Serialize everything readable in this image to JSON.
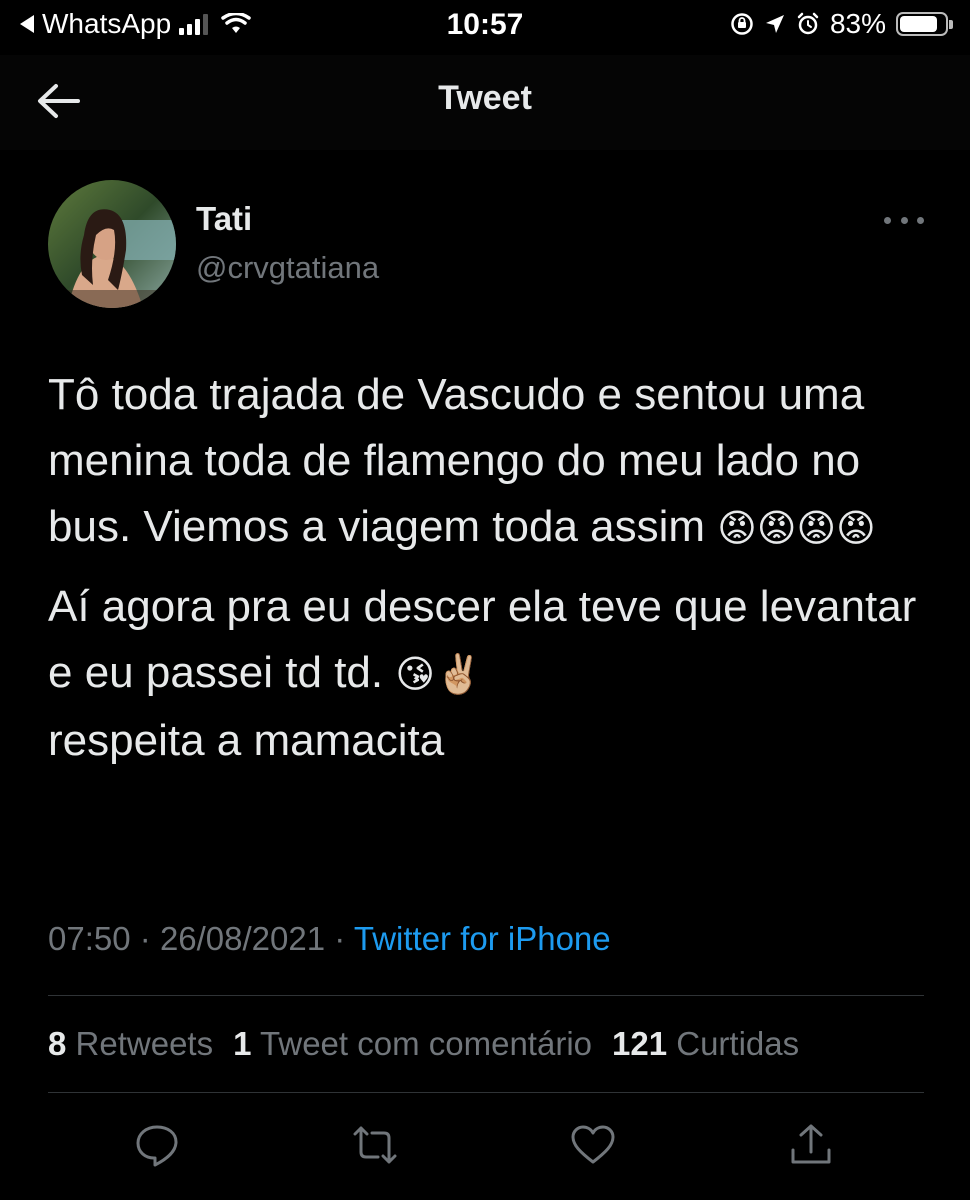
{
  "status_bar": {
    "back_app": "WhatsApp",
    "time": "10:57",
    "battery_percent": "83%",
    "battery_level": 0.83,
    "icons": [
      "signal-icon",
      "wifi-icon",
      "orientation-lock-icon",
      "location-icon",
      "alarm-icon",
      "battery-icon"
    ]
  },
  "header": {
    "title": "Tweet",
    "back_icon": "back-arrow-icon"
  },
  "tweet": {
    "author_name": "Tati",
    "author_handle": "@crvgtatiana",
    "paragraph_1": "Tô toda trajada de Vascudo e sentou uma menina toda de flamengo do meu lado no bus. Viemos a viagem toda assim ",
    "paragraph_1_emoji": "😡😡😡😡",
    "paragraph_2_a": "Aí agora pra eu descer ela teve que levantar e eu passei td td. ",
    "paragraph_2_emoji": "😘✌🏼",
    "paragraph_2_b": "respeita a mamacita",
    "time": "07:50",
    "date": "26/08/2021",
    "source": "Twitter for iPhone",
    "separator": "·"
  },
  "stats": {
    "retweets_count": "8",
    "retweets_label": "Retweets",
    "quotes_count": "1",
    "quotes_label": "Tweet com comentário",
    "likes_count": "121",
    "likes_label": "Curtidas"
  },
  "actions": [
    "reply-icon",
    "retweet-icon",
    "like-icon",
    "share-icon"
  ],
  "colors": {
    "background": "#000000",
    "text": "#e7e9ea",
    "muted": "#71767b",
    "link": "#1d9bf0",
    "divider": "#2f3336"
  }
}
